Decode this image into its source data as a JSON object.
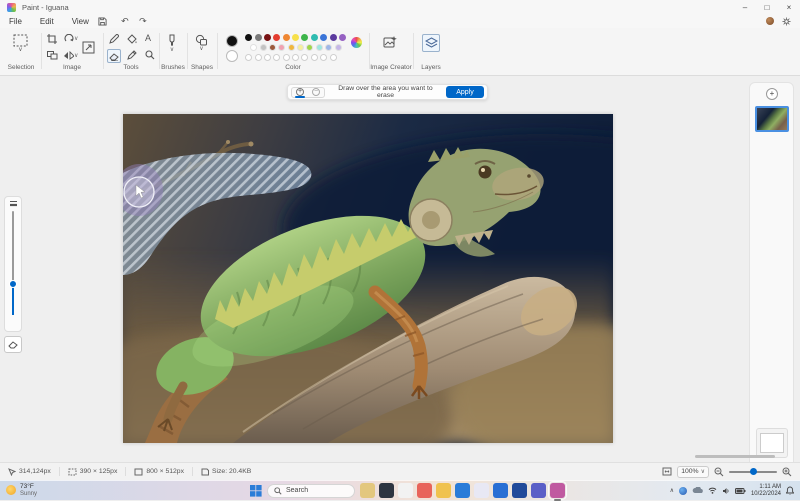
{
  "window": {
    "title": "Paint - Iguana",
    "minimize": "–",
    "maximize": "□",
    "close": "×"
  },
  "menu": {
    "items": [
      {
        "label": "File"
      },
      {
        "label": "Edit"
      },
      {
        "label": "View"
      }
    ]
  },
  "icons": {
    "undo": "↶",
    "redo": "↷",
    "chevron_down": "∨",
    "chevron_up": "∧",
    "text_tool": "A",
    "add": "+",
    "subtract": "−",
    "add_layer": "+"
  },
  "ribbon": {
    "labels": {
      "selection": "Selection",
      "image": "Image",
      "tools": "Tools",
      "brushes": "Brushes",
      "shapes": "Shapes",
      "color": "Color",
      "image_creator": "Image Creator",
      "layers": "Layers"
    },
    "colors": {
      "color1": "#111111",
      "color2": "#ffffff",
      "row1": [
        "#101010",
        "#7a7a7a",
        "#781214",
        "#e43d30",
        "#ef8733",
        "#f7e04a",
        "#3db54a",
        "#2fbcb0",
        "#3b75d8",
        "#5b3a9e",
        "#9561c2"
      ],
      "row2": [
        "#ffffff",
        "#c3c3c3",
        "#9c5a3c",
        "#f0a1b0",
        "#efb73e",
        "#f5ef9e",
        "#9fd54a",
        "#9fe7df",
        "#9fb7e7",
        "#c6b7e7"
      ],
      "custom": [
        null,
        null,
        null,
        null,
        null,
        null,
        null,
        null,
        null,
        null
      ]
    }
  },
  "erase_bar": {
    "message": "Draw over the area you want to erase",
    "apply": "Apply"
  },
  "status": {
    "cursor": "314,124px",
    "selection": "390 × 125px",
    "canvas": "800 × 512px",
    "size": "Size: 20.4KB",
    "zoom": "100%"
  },
  "taskbar": {
    "weather_temp": "73°F",
    "weather_cond": "Sunny",
    "search": "Search",
    "time": "1:11 AM",
    "date": "10/22/2024",
    "apps": [
      {
        "name": "taskbar-app-copilot",
        "color": "#e3c77e"
      },
      {
        "name": "taskbar-app-terminal",
        "color": "#2e3440"
      },
      {
        "name": "taskbar-app-notepad",
        "color": "#f2f2f2"
      },
      {
        "name": "taskbar-app-photos",
        "color": "#e8645a"
      },
      {
        "name": "taskbar-app-file-explorer",
        "color": "#f0c24e"
      },
      {
        "name": "taskbar-app-edge",
        "color": "#2b7cd8"
      },
      {
        "name": "taskbar-app-store",
        "color": "#e8e8f4"
      },
      {
        "name": "taskbar-app-outlook",
        "color": "#2a6fd4"
      },
      {
        "name": "taskbar-app-word",
        "color": "#224a9a"
      },
      {
        "name": "taskbar-app-teams",
        "color": "#5b5fc7"
      },
      {
        "name": "taskbar-app-paint",
        "color": "#c05aa0",
        "active": true
      }
    ]
  },
  "accent": "#0067c8"
}
